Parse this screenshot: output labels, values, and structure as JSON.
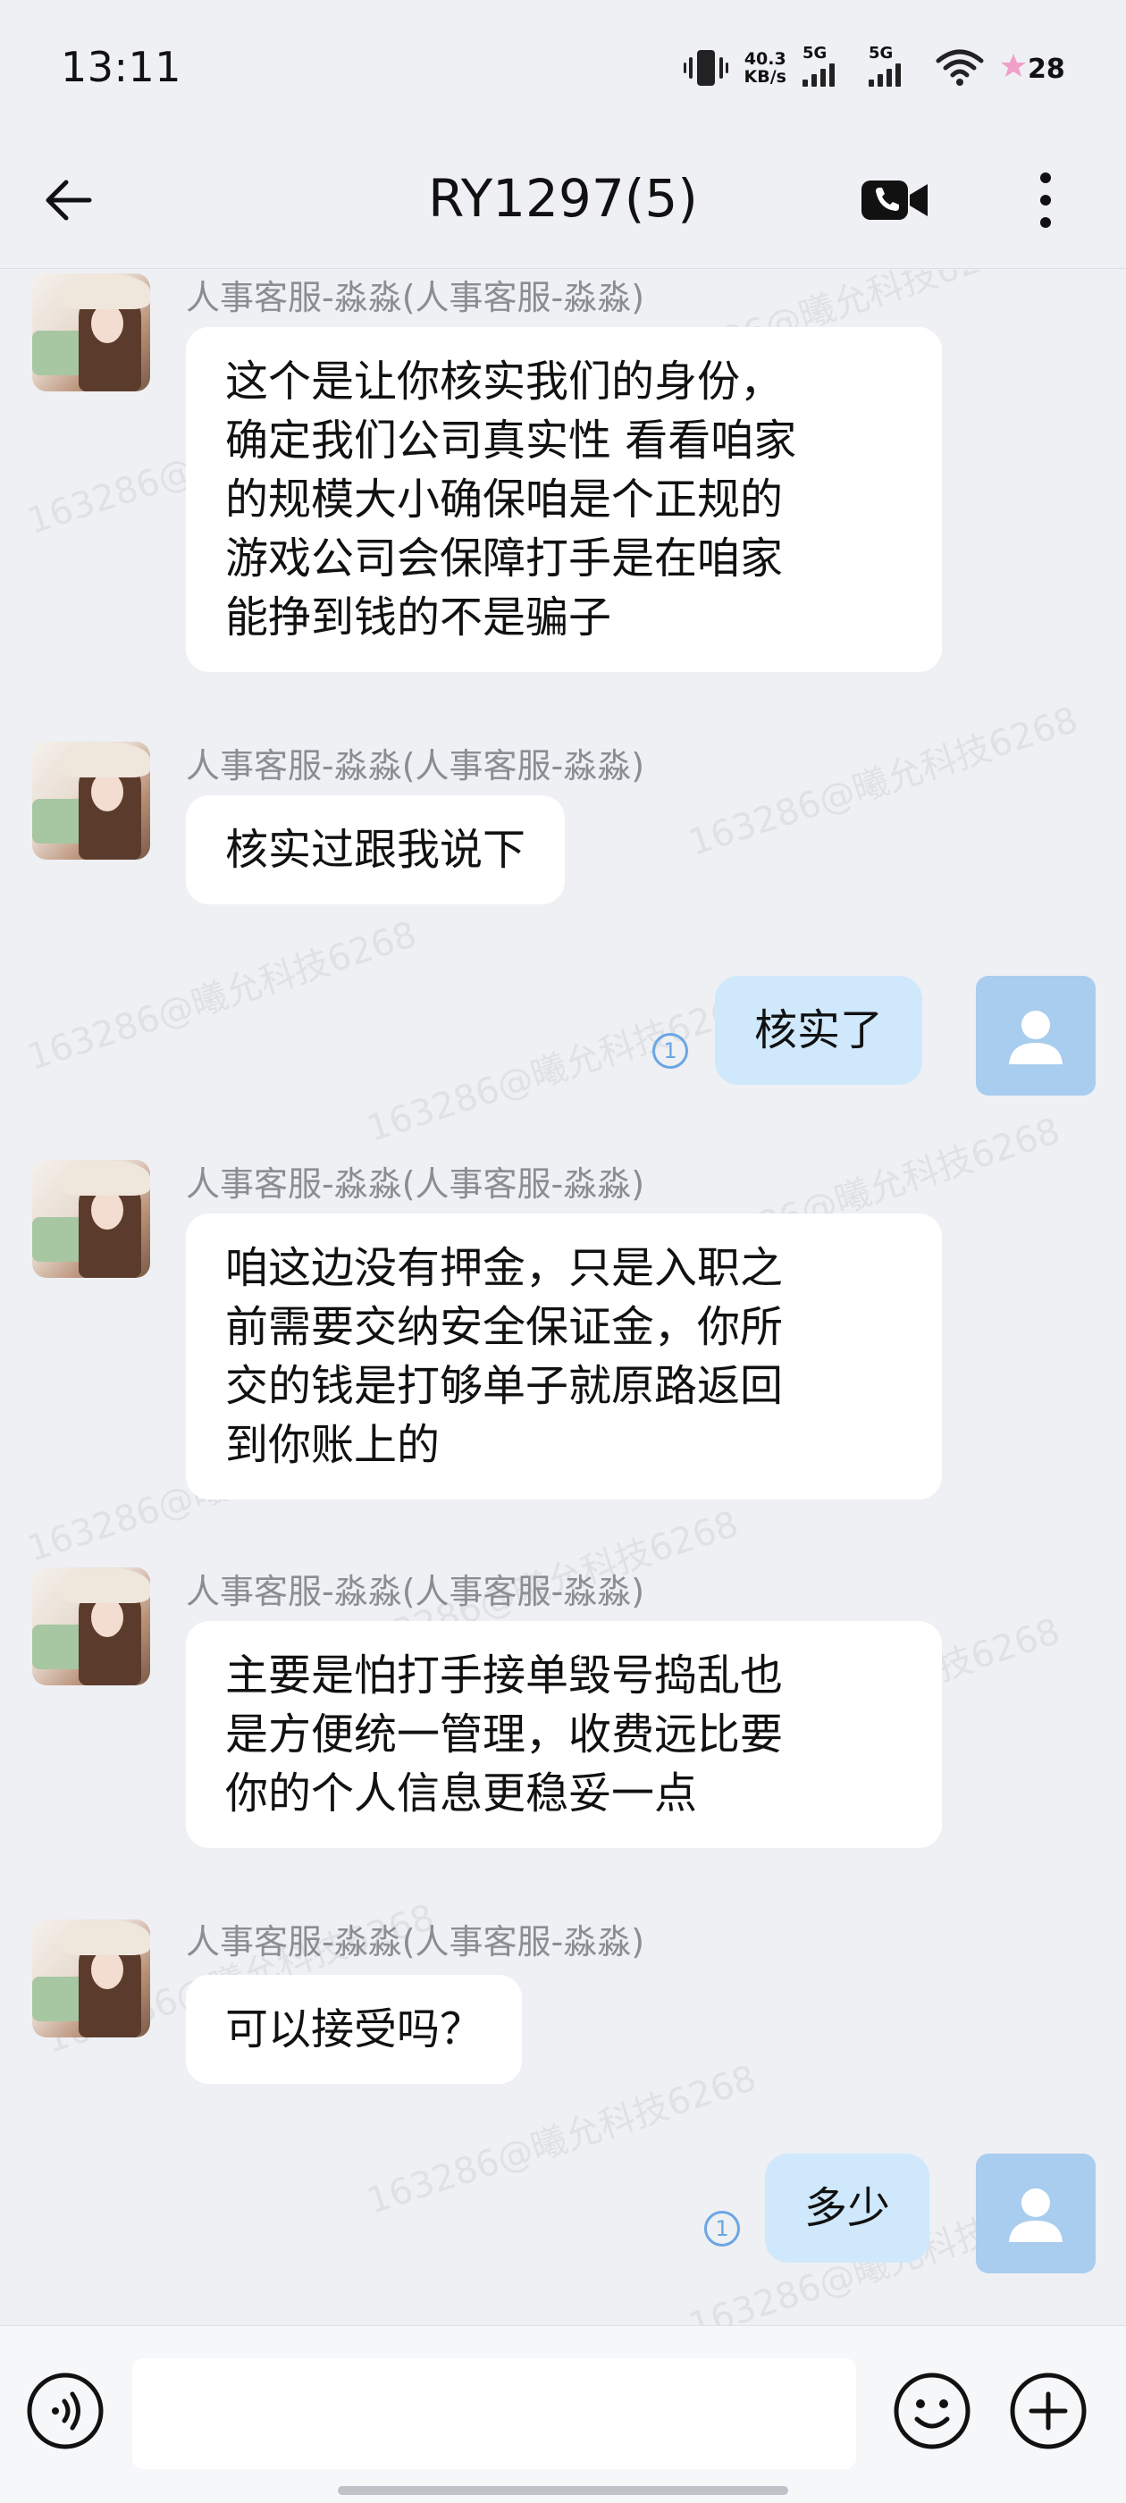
{
  "status_bar": {
    "time": "13:11",
    "net_speed_value": "40.3",
    "net_speed_unit": "KB/s",
    "sim1_label": "5G",
    "sim2_label": "5G",
    "battery_level": "28"
  },
  "header": {
    "title": "RY1297(5)",
    "back_icon": "arrow-left-icon",
    "video_icon": "video-call-icon",
    "more_icon": "more-vertical-icon"
  },
  "messages": [
    {
      "side": "left",
      "sender": "人事客服-淼淼(人事客服-淼淼)",
      "text": "这个是让你核实我们的身份，\n确定我们公司真实性 看看咱家\n的规模大小确保咱是个正规的\n游戏公司会保障打手是在咱家\n能挣到钱的不是骗子"
    },
    {
      "side": "left",
      "sender": "人事客服-淼淼(人事客服-淼淼)",
      "text": "核实过跟我说下"
    },
    {
      "side": "right",
      "text": "核实了",
      "read_count": "1"
    },
    {
      "side": "left",
      "sender": "人事客服-淼淼(人事客服-淼淼)",
      "text": "咱这边没有押金，只是入职之\n前需要交纳安全保证金，你所\n交的钱是打够单子就原路返回\n到你账上的"
    },
    {
      "side": "left",
      "sender": "人事客服-淼淼(人事客服-淼淼)",
      "text": "主要是怕打手接单毁号捣乱也\n是方便统一管理，收费远比要\n你的个人信息更稳妥一点"
    },
    {
      "side": "left",
      "sender": "人事客服-淼淼(人事客服-淼淼)",
      "text": "可以接受吗？"
    },
    {
      "side": "right",
      "text": "多少",
      "read_count": "1"
    }
  ],
  "watermark": "163286@曦允科技6268",
  "input_bar": {
    "placeholder": "",
    "voice_icon": "voice-input-icon",
    "emoji_icon": "emoji-icon",
    "plus_icon": "plus-icon"
  }
}
